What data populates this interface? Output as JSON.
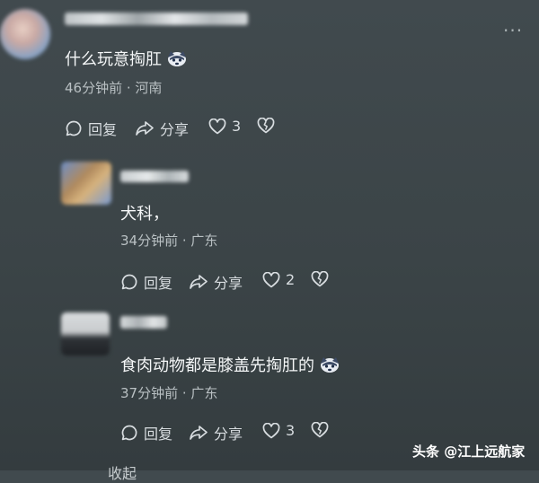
{
  "more_label": "···",
  "comments": [
    {
      "text": "什么玩意掏肛",
      "meta": "46分钟前 · 河南",
      "reply_label": "回复",
      "share_label": "分享",
      "like_count": "3"
    },
    {
      "text": "犬科，",
      "meta": "34分钟前 · 广东",
      "reply_label": "回复",
      "share_label": "分享",
      "like_count": "2"
    },
    {
      "text": "食肉动物都是膝盖先掏肛的",
      "meta": "37分钟前 · 广东",
      "reply_label": "回复",
      "share_label": "分享",
      "like_count": "3"
    }
  ],
  "footer_partial": "收起",
  "watermark": "头条 @江上远航家",
  "icons": [
    "comment-bubble-icon",
    "share-arrow-icon",
    "heart-icon",
    "broken-heart-icon",
    "husky-emoji-icon"
  ]
}
